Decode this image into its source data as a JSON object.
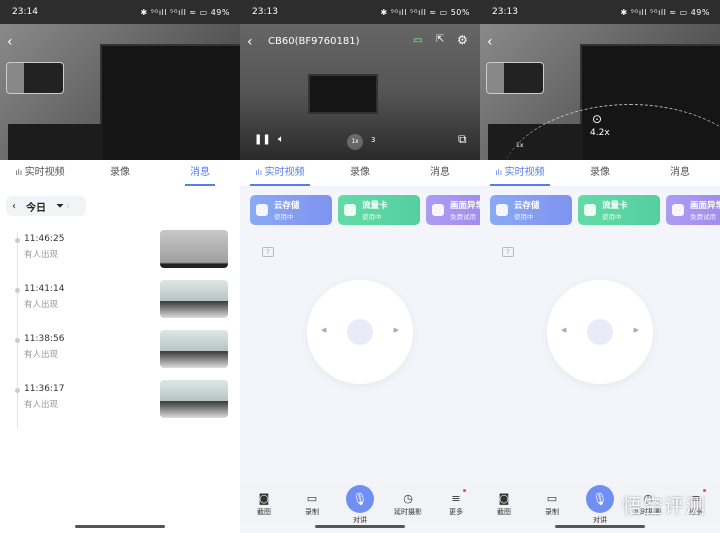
{
  "screens": [
    {
      "status": {
        "time": "23:14",
        "icons": "✱ ⁵ᴳıll ⁵ᴳıll ≈ ▭",
        "battery": "49%"
      },
      "tabs": [
        "实时视频",
        "录像",
        "消息"
      ],
      "active_tab": 2,
      "filter": {
        "day": "今日"
      },
      "messages": [
        {
          "time": "11:46:25",
          "desc": "有人出现"
        },
        {
          "time": "11:41:14",
          "desc": "有人出现"
        },
        {
          "time": "11:38:56",
          "desc": "有人出现"
        },
        {
          "time": "11:36:17",
          "desc": "有人出现"
        }
      ]
    },
    {
      "status": {
        "time": "23:13",
        "icons": "✱ ⁵ᴳıll ⁵ᴳıll ≈ ▭",
        "battery": "50%"
      },
      "device_title": "CB60(BF9760181)",
      "speed_options": [
        "1x",
        "3"
      ],
      "tabs": [
        "实时视频",
        "录像",
        "消息"
      ],
      "active_tab": 0,
      "cards": [
        {
          "title": "云存储",
          "sub": "使用中",
          "color": "#7f93ef"
        },
        {
          "title": "流量卡",
          "sub": "使用中",
          "color": "#55cf9f"
        },
        {
          "title": "画面异常",
          "sub": "免费试用",
          "color": "#9b85ea"
        }
      ],
      "help": "?",
      "toolbar": [
        "截图",
        "录制",
        "对讲",
        "延时摄影",
        "更多"
      ]
    },
    {
      "status": {
        "time": "23:13",
        "icons": "✱ ⁵ᴳıll ⁵ᴳıll ≈ ▭",
        "battery": "49%"
      },
      "zoom_level": "4.2x",
      "zoom_min": "1x",
      "tabs": [
        "实时视频",
        "录像",
        "消息"
      ],
      "active_tab": 0,
      "cards": [
        {
          "title": "云存储",
          "sub": "使用中"
        },
        {
          "title": "流量卡",
          "sub": "使用中"
        },
        {
          "title": "画面异常",
          "sub": "免费试用"
        }
      ],
      "help": "?",
      "toolbar": [
        "截图",
        "录制",
        "对讲",
        "延时摄影",
        "更多"
      ],
      "watermark": "悟空评测"
    }
  ],
  "accent": "#5b7cf0"
}
